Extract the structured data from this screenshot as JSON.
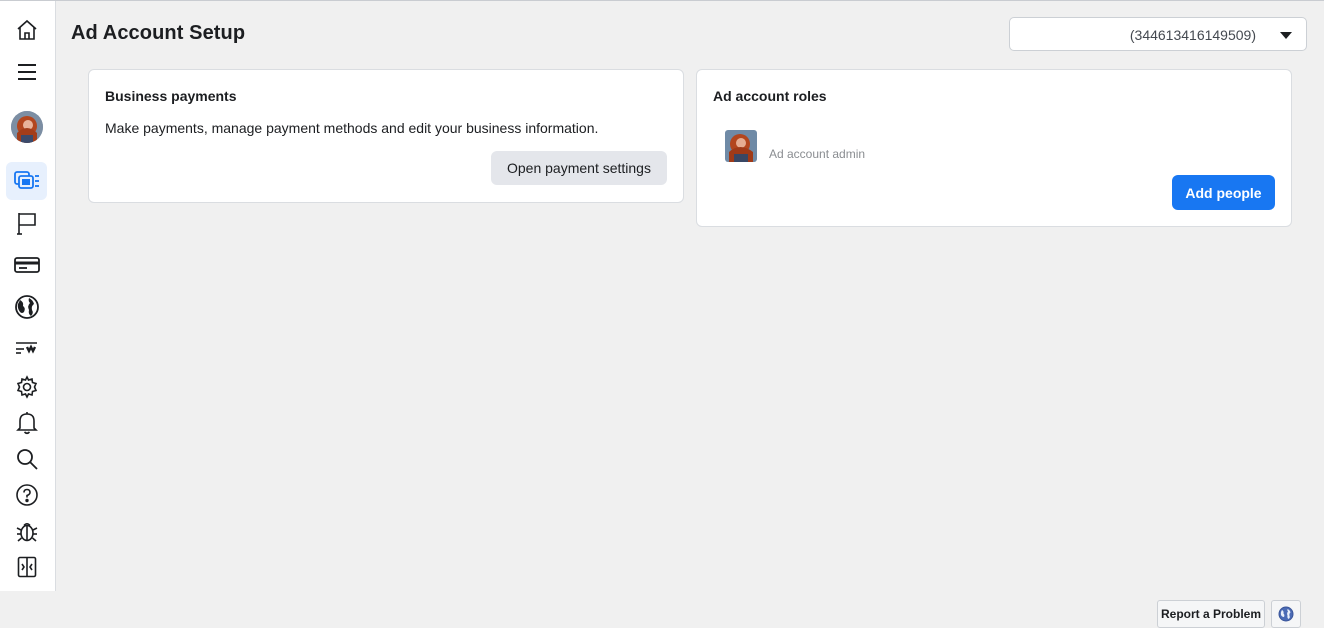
{
  "page": {
    "title": "Ad Account Setup"
  },
  "account_selector": {
    "value": "(344613416149509)"
  },
  "sidebar": {
    "items": [
      {
        "icon": "home-icon"
      },
      {
        "icon": "menu-icon"
      },
      {
        "icon": "profile-avatar"
      },
      {
        "icon": "ad-accounts-icon",
        "active": true
      },
      {
        "icon": "flag-icon"
      },
      {
        "icon": "credit-card-icon"
      },
      {
        "icon": "globe-icon"
      },
      {
        "icon": "ad-settings-icon"
      },
      {
        "icon": "gear-icon"
      },
      {
        "icon": "bell-icon"
      },
      {
        "icon": "search-icon"
      },
      {
        "icon": "help-icon"
      },
      {
        "icon": "bug-icon"
      },
      {
        "icon": "collapse-panel-icon"
      }
    ]
  },
  "business_payments": {
    "title": "Business payments",
    "description": "Make payments, manage payment methods and edit your business information.",
    "button_label": "Open payment settings"
  },
  "ad_account_roles": {
    "title": "Ad account roles",
    "role_label": "Ad account admin",
    "add_button_label": "Add people"
  },
  "footer": {
    "report_label": "Report a Problem",
    "globe_icon": "globe-icon"
  },
  "colors": {
    "accent": "#1877f2",
    "active_bg": "#e7f0fd",
    "page_bg": "#f0f0f0"
  }
}
